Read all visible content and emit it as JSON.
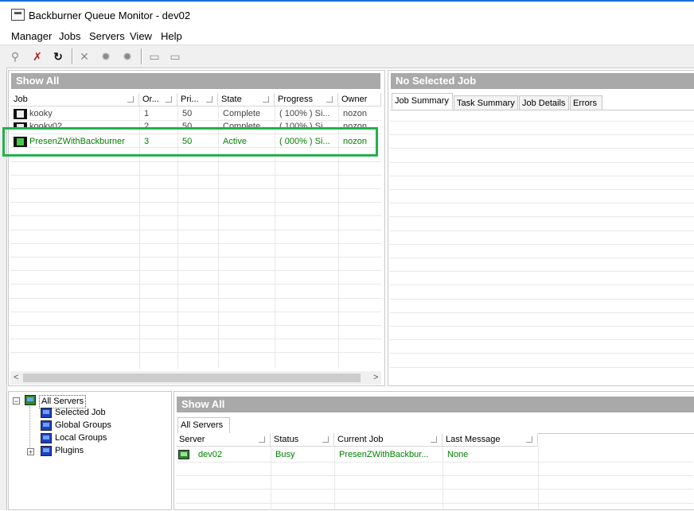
{
  "window": {
    "title": "Backburner Queue Monitor - dev02"
  },
  "menu": [
    "Manager",
    "Jobs",
    "Servers",
    "View",
    "Help"
  ],
  "toolbar": {
    "buttons": [
      {
        "icon": "connect-icon",
        "enabled": false
      },
      {
        "icon": "disconnect-icon",
        "enabled": true
      },
      {
        "icon": "refresh-icon",
        "enabled": true
      },
      {
        "icon": "delete-icon",
        "enabled": false
      },
      {
        "icon": "activate-icon",
        "enabled": false
      },
      {
        "icon": "deactivate-icon",
        "enabled": false
      },
      {
        "icon": "server-properties-icon",
        "enabled": false
      },
      {
        "icon": "server-list-icon",
        "enabled": false
      }
    ]
  },
  "jobs_panel": {
    "header": "Show All",
    "columns": [
      "Job",
      "Or...",
      "Pri...",
      "State",
      "Progress",
      "Owner"
    ],
    "rows": [
      {
        "job": "kooky",
        "order": "1",
        "priority": "50",
        "state": "Complete",
        "progress": "( 100% ) Si...",
        "owner": "nozon"
      },
      {
        "job": "kooky02",
        "order": "2",
        "priority": "50",
        "state": "Complete",
        "progress": "( 100% ) Si...",
        "owner": "nozon"
      },
      {
        "job": "PresenZWithBackburner",
        "order": "3",
        "priority": "50",
        "state": "Active",
        "progress": "( 000% ) Si...",
        "owner": "nozon"
      }
    ],
    "highlight_color": "#22b14c"
  },
  "job_detail_panel": {
    "header": "No Selected Job",
    "tabs": [
      "Job Summary",
      "Task Summary",
      "Job Details",
      "Errors"
    ]
  },
  "server_tree": {
    "root": "All Servers",
    "children": [
      "Selected Job",
      "Global Groups",
      "Local Groups",
      "Plugins"
    ]
  },
  "servers_panel": {
    "header": "Show All",
    "tab": "All Servers",
    "columns": [
      "Server",
      "Status",
      "Current Job",
      "Last Message"
    ],
    "rows": [
      {
        "server": "dev02",
        "status": "Busy",
        "current_job": "PresenZWithBackbur...",
        "last_message": "None"
      }
    ]
  }
}
